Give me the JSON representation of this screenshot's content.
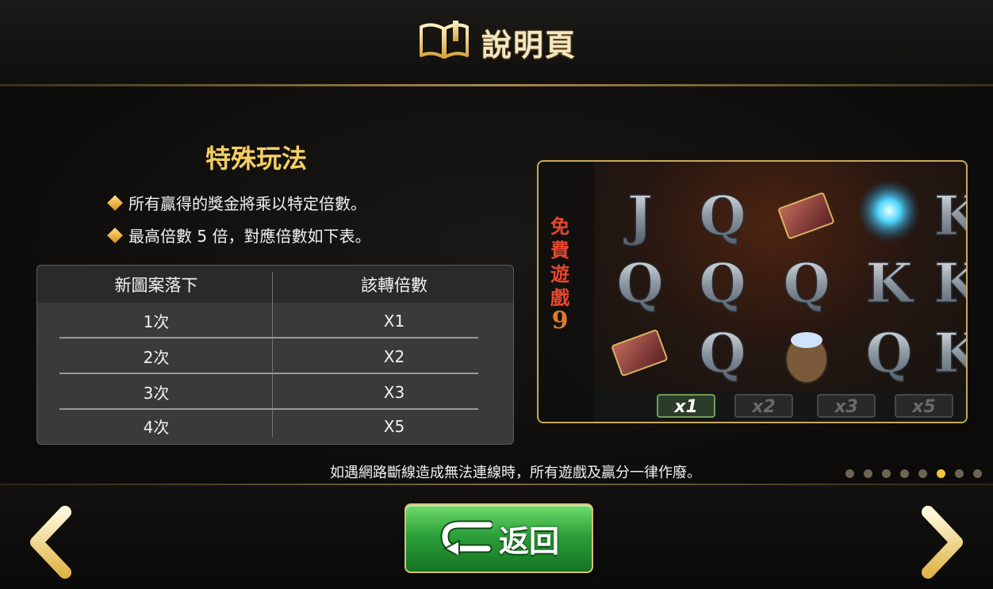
{
  "header": {
    "title": "說明頁",
    "icon": "open-book-icon"
  },
  "section": {
    "title": "特殊玩法",
    "bullets": [
      "所有贏得的獎金將乘以特定倍數。",
      "最高倍數 5 倍，對應倍數如下表。"
    ]
  },
  "table": {
    "headers": [
      "新圖案落下",
      "該轉倍數"
    ],
    "rows": [
      [
        "1次",
        "X1"
      ],
      [
        "2次",
        "X2"
      ],
      [
        "3次",
        "X3"
      ],
      [
        "4次",
        "X5"
      ]
    ]
  },
  "preview": {
    "side_label": [
      "免",
      "費",
      "遊",
      "戲",
      "9"
    ],
    "reel_letters": [
      [
        "J",
        "Q",
        "book",
        "orb",
        "K"
      ],
      [
        "Q",
        "Q",
        "Q",
        "K",
        "K"
      ],
      [
        "book",
        "Q",
        "coins",
        "Q",
        "K"
      ]
    ],
    "multipliers": [
      "x1",
      "x2",
      "x3",
      "x5"
    ],
    "active_multiplier": "x1"
  },
  "notice": "如遇網路斷線造成無法連線時，所有遊戲及贏分一律作廢。",
  "pagination": {
    "total": 8,
    "current": 6
  },
  "buttons": {
    "back_label": "返回",
    "back_icon": "return-arrow-icon",
    "prev_icon": "chevron-left-icon",
    "next_icon": "chevron-right-icon"
  },
  "colors": {
    "title_gold": "#f4cf63",
    "frame_gold": "#c9a85a",
    "button_green": "#2ea13a",
    "dot_active": "#f5c23b"
  }
}
